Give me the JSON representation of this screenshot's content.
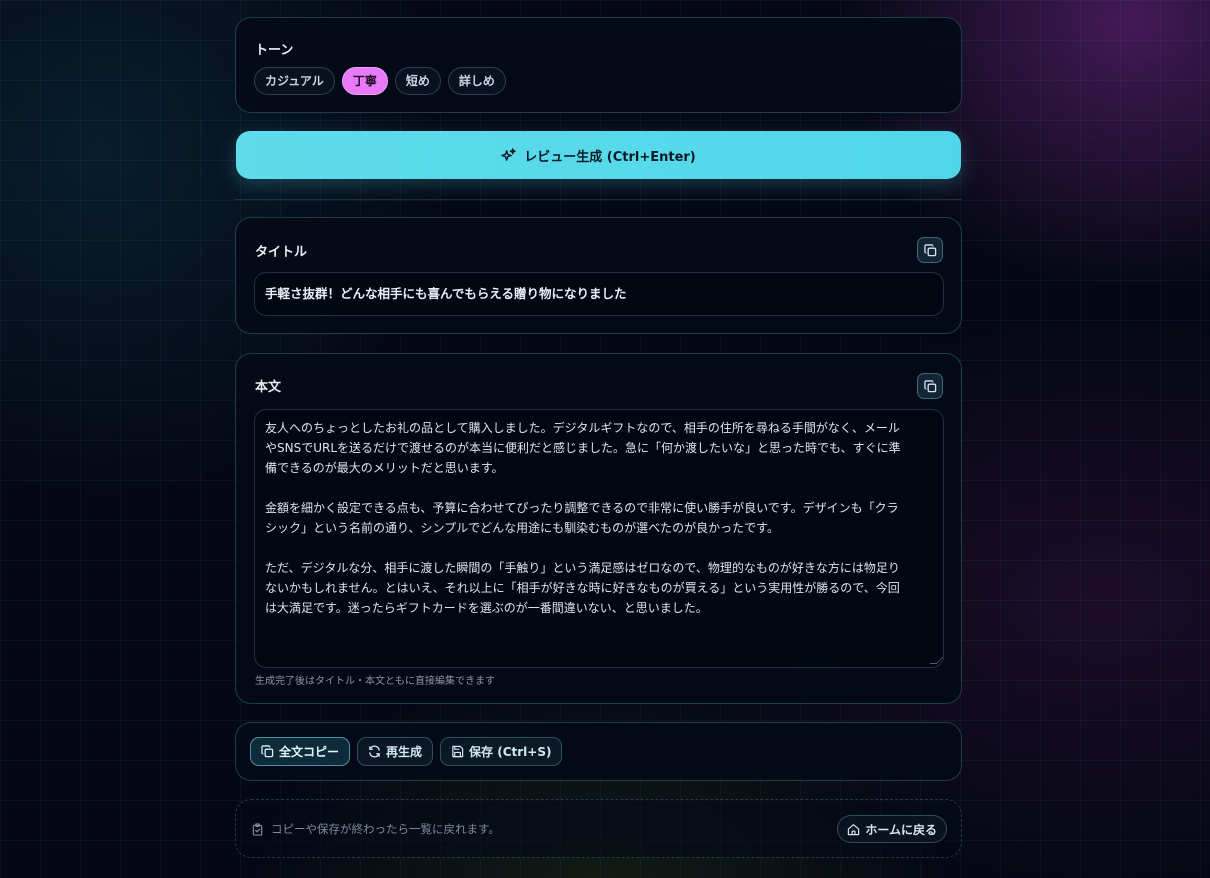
{
  "tone": {
    "label": "トーン",
    "options": [
      "カジュアル",
      "丁寧",
      "短め",
      "詳しめ"
    ],
    "selected": "丁寧"
  },
  "generate": {
    "label": "レビュー生成 (Ctrl+Enter)",
    "icon": "sparkles-icon"
  },
  "title_section": {
    "label": "タイトル",
    "value": "手軽さ抜群！どんな相手にも喜んでもらえる贈り物になりました",
    "copy_icon": "copy-icon"
  },
  "body_section": {
    "label": "本文",
    "paragraphs": [
      "友人へのちょっとしたお礼の品として購入しました。デジタルギフトなので、相手の住所を尋ねる手間がなく、メールやSNSでURLを送るだけで渡せるのが本当に便利だと感じました。急に「何か渡したいな」と思った時でも、すぐに準備できるのが最大のメリットだと思います。",
      "金額を細かく設定できる点も、予算に合わせてぴったり調整できるので非常に使い勝手が良いです。デザインも「クラシック」という名前の通り、シンプルでどんな用途にも馴染むものが選べたのが良かったです。",
      "ただ、デジタルな分、相手に渡した瞬間の「手触り」という満足感はゼロなので、物理的なものが好きな方には物足りないかもしれません。とはいえ、それ以上に「相手が好きな時に好きなものが買える」という実用性が勝るので、今回は大満足です。迷ったらギフトカードを選ぶのが一番間違いない、と思いました。"
    ],
    "hint": "生成完了後はタイトル・本文ともに直接編集できます",
    "copy_icon": "copy-icon"
  },
  "actions": {
    "copy_all": "全文コピー",
    "regenerate": "再生成",
    "save": "保存 (Ctrl+S)"
  },
  "footer": {
    "note": "コピーや保存が終わったら一覧に戻れます。",
    "home_button": "ホームに戻る"
  },
  "colors": {
    "accent": "#4fd7e9",
    "selected_chip": "#e879f9",
    "background": "#050814"
  }
}
